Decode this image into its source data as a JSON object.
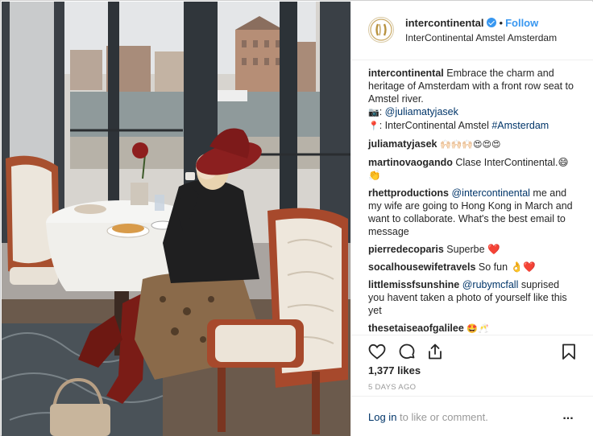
{
  "header": {
    "username": "intercontinental",
    "separator": "•",
    "follow_label": "Follow",
    "location": "InterContinental Amstel Amsterdam"
  },
  "caption": {
    "username": "intercontinental",
    "text": "Embrace the charm and heritage of Amsterdam with a front row seat to Amstel river.",
    "camera_emoji": "📷",
    "camera_prefix": ": ",
    "photo_credit": "@juliamatyjasek",
    "pin_emoji": "📍",
    "location_prefix": ": InterContinental Amstel ",
    "hashtag": "#Amsterdam"
  },
  "comments": [
    {
      "username": "juliamatyjasek",
      "text": "🙌🏻🙌🏻🙌🏻😍😍😍"
    },
    {
      "username": "martinovaogando",
      "text": "Clase InterContinental.😄👏"
    },
    {
      "username": "rhettproductions",
      "mention": "@intercontinental",
      "text": " me and my wife are going to Hong Kong in March and want to collaborate. What's the best email to message"
    },
    {
      "username": "pierredecoparis",
      "text": "Superbe ❤️"
    },
    {
      "username": "socalhousewifetravels",
      "text": "So fun 👌❤️"
    },
    {
      "username": "littlemissfsunshine",
      "mention": "@rubymcfall",
      "text": " suprised you havent taken a photo of yourself like this yet"
    },
    {
      "username": "thesetaiseaofgalilee",
      "text": "🤩🥂"
    }
  ],
  "stats": {
    "likes": "1,377 likes",
    "time_ago": "5 DAYS AGO"
  },
  "footer": {
    "login_label": "Log in",
    "rest": " to like or comment.",
    "more": "..."
  },
  "icons": {
    "like": "heart-icon",
    "comment": "comment-icon",
    "share": "share-icon",
    "save": "bookmark-icon",
    "more": "more-icon"
  },
  "colors": {
    "link_blue": "#003569",
    "follow_blue": "#3897f0",
    "muted": "#999999",
    "hat_red": "#8b1f1f",
    "boots_red": "#7a1c16"
  }
}
